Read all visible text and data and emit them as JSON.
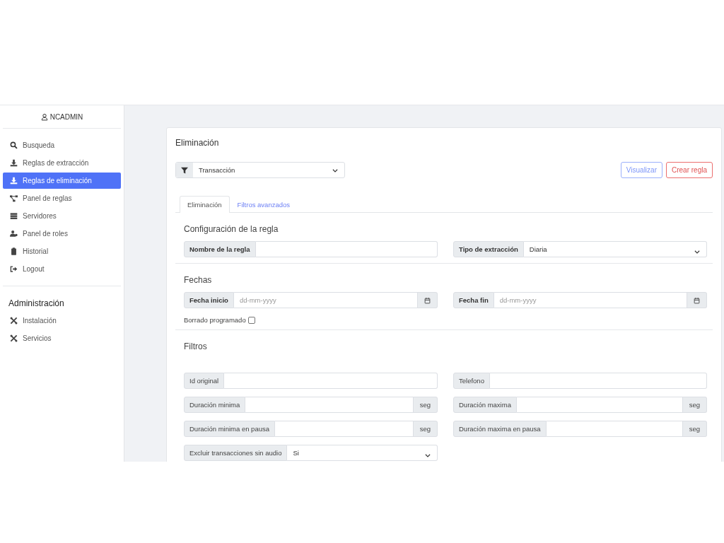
{
  "user": {
    "name": "NCADMIN"
  },
  "nav": [
    {
      "label": "Busqueda",
      "selected": false
    },
    {
      "label": "Reglas de extracción",
      "selected": false
    },
    {
      "label": "Reglas de eliminación",
      "selected": true
    },
    {
      "label": "Panel de reglas",
      "selected": false
    },
    {
      "label": "Servidores",
      "selected": false
    },
    {
      "label": "Panel de roles",
      "selected": false
    },
    {
      "label": "Historial",
      "selected": false
    },
    {
      "label": "Logout",
      "selected": false
    }
  ],
  "admin": {
    "title": "Administración",
    "items": [
      {
        "label": "Instalación",
        "selected": false
      },
      {
        "label": "Servicios",
        "selected": false
      }
    ]
  },
  "card": {
    "title": "Eliminación",
    "type_select": {
      "value": "Transacción"
    },
    "buttons": [
      {
        "label": "Visualizar",
        "kind": "primary"
      },
      {
        "label": "Crear regla",
        "kind": "danger"
      }
    ],
    "tabs": [
      {
        "label": "Eliminación",
        "selected": true
      },
      {
        "label": "Filtros avanzados",
        "selected": false
      }
    ],
    "sections": [
      {
        "title": "Configuración de la regla",
        "fields": [
          {
            "kind": "text",
            "label": "Nombre de la regla",
            "strong": true
          },
          {
            "kind": "select",
            "label": "Tipo de extracción",
            "value": "Diaria",
            "strong": true
          }
        ]
      },
      {
        "title": "Fechas",
        "fields": [
          {
            "kind": "date",
            "label": "Fecha inicio",
            "placeholder": "dd-mm-yyyy",
            "strong": true
          },
          {
            "kind": "date",
            "label": "Fecha fin",
            "placeholder": "dd-mm-yyyy",
            "strong": true
          }
        ],
        "checkbox": {
          "label": "Borrado programado",
          "checked": false
        }
      },
      {
        "title": "Filtros",
        "fields": [
          {
            "kind": "text",
            "label": "Id original"
          },
          {
            "kind": "text",
            "label": "Telefono"
          },
          {
            "kind": "suffix",
            "label": "Duración minima",
            "suffix": "seg"
          },
          {
            "kind": "suffix",
            "label": "Duración maxima",
            "suffix": "seg"
          },
          {
            "kind": "suffix",
            "label": "Duración minima en pausa",
            "suffix": "seg"
          },
          {
            "kind": "suffix",
            "label": "Duración maxima en pausa",
            "suffix": "seg"
          },
          {
            "kind": "select",
            "label": "Excluir transacciones sin audio",
            "value": "Si"
          }
        ]
      }
    ]
  }
}
